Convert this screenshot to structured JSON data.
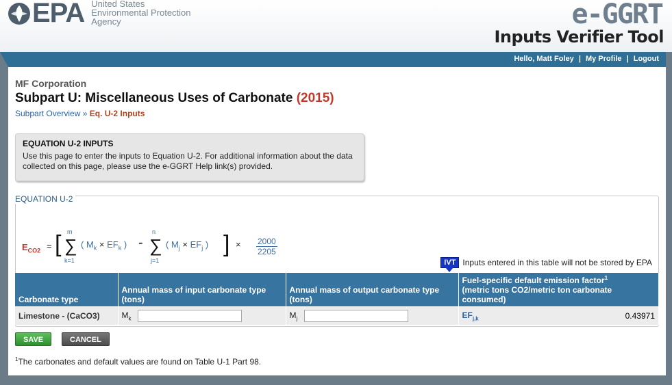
{
  "header": {
    "logo_text": "EPA",
    "agency_line1": "United States",
    "agency_line2": "Environmental Protection",
    "agency_line3": "Agency",
    "app_brand": "e-GGRT",
    "tool_title": "Inputs Verifier Tool"
  },
  "user_nav": {
    "greeting": "Hello, Matt Foley",
    "profile": "My Profile",
    "logout": "Logout",
    "separator": "|"
  },
  "page": {
    "company": "MF Corporation",
    "title": "Subpart U: Miscellaneous Uses of Carbonate",
    "year": "(2015)",
    "breadcrumb": {
      "overview": "Subpart Overview",
      "sep": "»",
      "current": "Eq. U-2 Inputs"
    }
  },
  "info_box": {
    "title": "EQUATION U-2 INPUTS",
    "text": "Use this page to enter the inputs to Equation U-2. For additional information about the data collected on this page, please use the e-GGRT Help link(s) provided."
  },
  "equation": {
    "legend": "EQUATION U-2",
    "e": "E",
    "e_sub": "CO2",
    "equals": "=",
    "sum1_top": "m",
    "sum1_bottom": "k=1",
    "term1": "( Mk × EFk )",
    "minus": "-",
    "sum2_top": "n",
    "sum2_bottom": "j=1",
    "term2": "( Mj × EFj )",
    "times": "×",
    "frac_num": "2000",
    "frac_den": "2205"
  },
  "ivt_note": {
    "badge": "IVT",
    "text": "Inputs entered in this table will not be stored by EPA"
  },
  "table": {
    "headers": {
      "carbonate_type": "Carbonate type",
      "input_mass": "Annual mass of input carbonate type",
      "input_unit": "(tons)",
      "output_mass": "Annual mass of output carbonate type",
      "output_unit": "(tons)",
      "ef": "Fuel-specific default emission factor",
      "ef_sup": "1",
      "ef_unit": "(metric tons CO2/metric ton carbonate consumed)"
    },
    "rows": [
      {
        "carbonate": "Limestone - (CaCO3)",
        "mk_label": "M",
        "mk_sub": "k",
        "mk_value": "",
        "mj_label": "M",
        "mj_sub": "j",
        "mj_value": "",
        "ef_label": "EF",
        "ef_sub": "j,k",
        "ef_value": "0.43971"
      }
    ]
  },
  "buttons": {
    "save": "SAVE",
    "cancel": "CANCEL"
  },
  "footnote": {
    "sup": "1",
    "text": "The carbonates and default values are found on Table U-1 Part 98."
  },
  "colors": {
    "header_bar": "#2f6e95",
    "table_header": "#3874a0",
    "year_red": "#c0392b",
    "save_green": "#3a9f3a"
  }
}
